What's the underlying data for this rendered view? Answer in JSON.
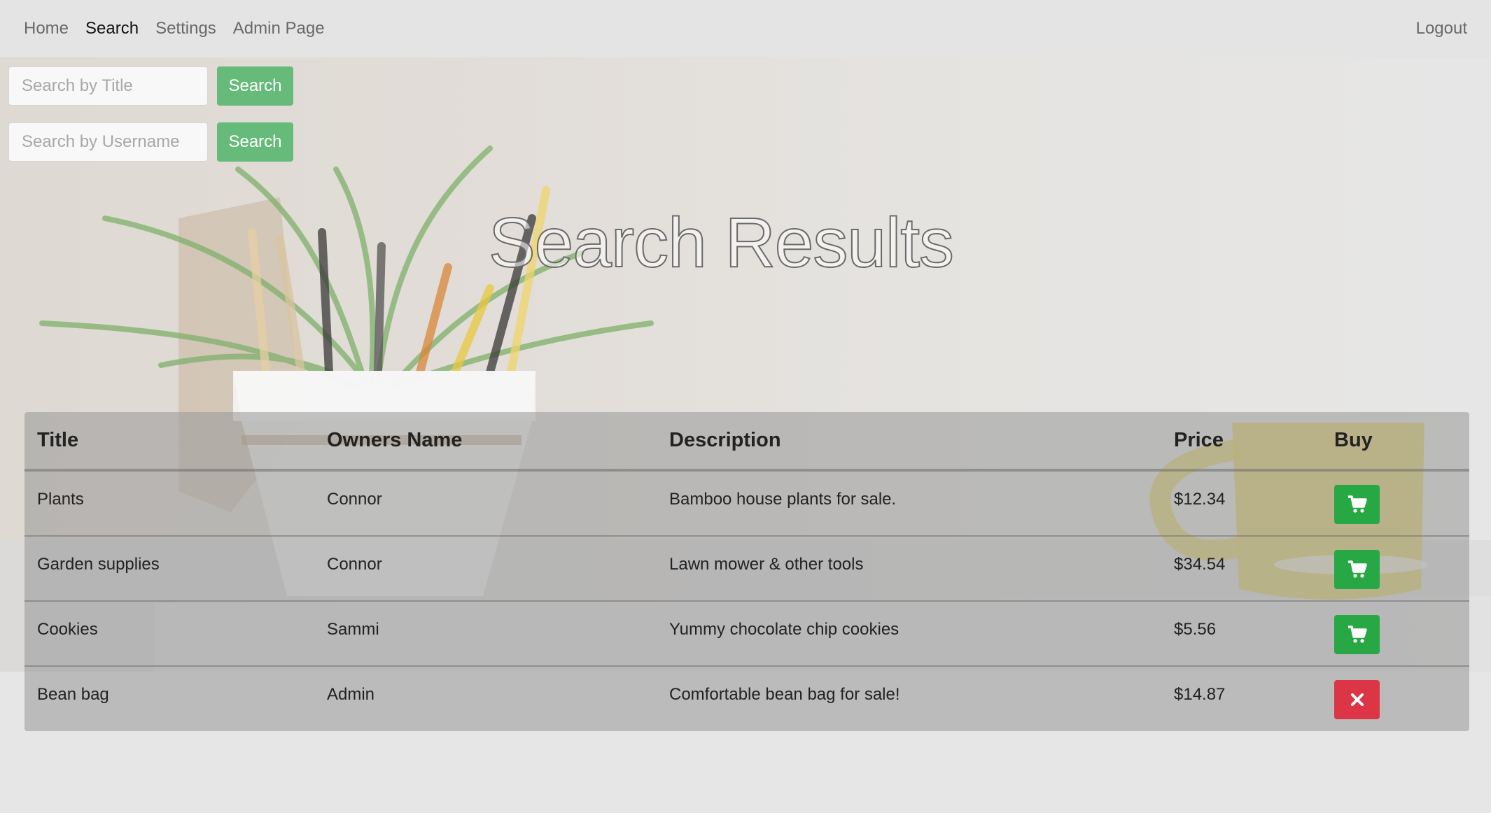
{
  "nav": {
    "home": "Home",
    "search": "Search",
    "settings": "Settings",
    "admin": "Admin Page",
    "logout": "Logout"
  },
  "search": {
    "title_placeholder": "Search by Title",
    "title_button": "Search",
    "username_placeholder": "Search by Username",
    "username_button": "Search"
  },
  "page_title": "Search Results",
  "table": {
    "headers": {
      "title": "Title",
      "owner": "Owners Name",
      "description": "Description",
      "price": "Price",
      "buy": "Buy"
    },
    "rows": [
      {
        "title": "Plants",
        "owner": "Connor",
        "description": "Bamboo house plants for sale.",
        "price": "$12.34",
        "action": "cart-icon"
      },
      {
        "title": "Garden supplies",
        "owner": "Connor",
        "description": "Lawn mower & other tools",
        "price": "$34.54",
        "action": "cart-icon"
      },
      {
        "title": "Cookies",
        "owner": "Sammi",
        "description": "Yummy chocolate chip cookies",
        "price": "$5.56",
        "action": "cart-icon"
      },
      {
        "title": "Bean bag",
        "owner": "Admin",
        "description": "Comfortable bean bag for sale!",
        "price": "$14.87",
        "action": "close-icon"
      }
    ]
  },
  "colors": {
    "search_button": "#66bb7a",
    "buy_button": "#28a745",
    "remove_button": "#dc3545"
  }
}
